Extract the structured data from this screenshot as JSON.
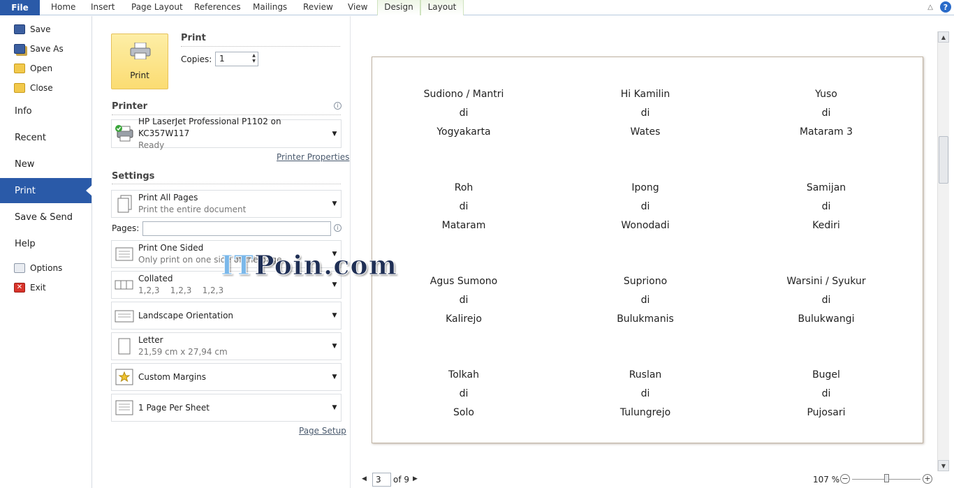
{
  "ribbon": {
    "file": "File",
    "tabs": [
      "Home",
      "Insert",
      "Page Layout",
      "References",
      "Mailings",
      "Review",
      "View"
    ],
    "context_tabs": [
      "Design",
      "Layout"
    ]
  },
  "nav": {
    "commands_top": [
      {
        "label": "Save",
        "icon": "save-icon"
      },
      {
        "label": "Save As",
        "icon": "save-as-icon"
      },
      {
        "label": "Open",
        "icon": "open-folder-icon"
      },
      {
        "label": "Close",
        "icon": "close-folder-icon"
      }
    ],
    "tabs": [
      "Info",
      "Recent",
      "New",
      "Print",
      "Save & Send",
      "Help"
    ],
    "active_tab": "Print",
    "commands_bottom": [
      {
        "label": "Options",
        "icon": "options-icon"
      },
      {
        "label": "Exit",
        "icon": "exit-icon"
      }
    ],
    "accent_color": "#2a5aa8"
  },
  "print": {
    "section_title": "Print",
    "button_label": "Print",
    "copies_label": "Copies:",
    "copies_value": "1"
  },
  "printer": {
    "section_title": "Printer",
    "name": "HP LaserJet Professional P1102 on KC357W117",
    "status": "Ready",
    "properties_link": "Printer Properties"
  },
  "settings": {
    "section_title": "Settings",
    "print_range": {
      "title": "Print All Pages",
      "subtitle": "Print the entire document"
    },
    "pages_label": "Pages:",
    "pages_value": "",
    "sides": {
      "title": "Print One Sided",
      "subtitle": "Only print on one side of the page"
    },
    "collate": {
      "title": "Collated",
      "subtitle": "1,2,3    1,2,3    1,2,3"
    },
    "orientation": {
      "title": "Landscape Orientation"
    },
    "paper": {
      "title": "Letter",
      "subtitle": "21,59 cm x 27,94 cm"
    },
    "margins": {
      "title": "Custom Margins"
    },
    "per_sheet": {
      "title": "1 Page Per Sheet"
    },
    "page_setup_link": "Page Setup"
  },
  "preview": {
    "labels": [
      [
        "Sudiono / Mantri",
        "di",
        "Yogyakarta"
      ],
      [
        "Hi Kamilin",
        "di",
        "Wates"
      ],
      [
        "Yuso",
        "di",
        "Mataram 3"
      ],
      [
        "Roh",
        "di",
        "Mataram"
      ],
      [
        "Ipong",
        "di",
        "Wonodadi"
      ],
      [
        "Samijan",
        "di",
        "Kediri"
      ],
      [
        "Agus Sumono",
        "di",
        "Kalirejo"
      ],
      [
        "Supriono",
        "di",
        "Bulukmanis"
      ],
      [
        "Warsini / Syukur",
        "di",
        "Bulukwangi"
      ],
      [
        "Tolkah",
        "di",
        "Solo"
      ],
      [
        "Ruslan",
        "di",
        "Tulungrejo"
      ],
      [
        "Bugel",
        "di",
        "Pujosari"
      ]
    ],
    "current_page": "3",
    "of_pages": "of 9",
    "zoom": "107 %"
  },
  "watermark": {
    "it": "IT",
    "rest": "Poin.com"
  }
}
